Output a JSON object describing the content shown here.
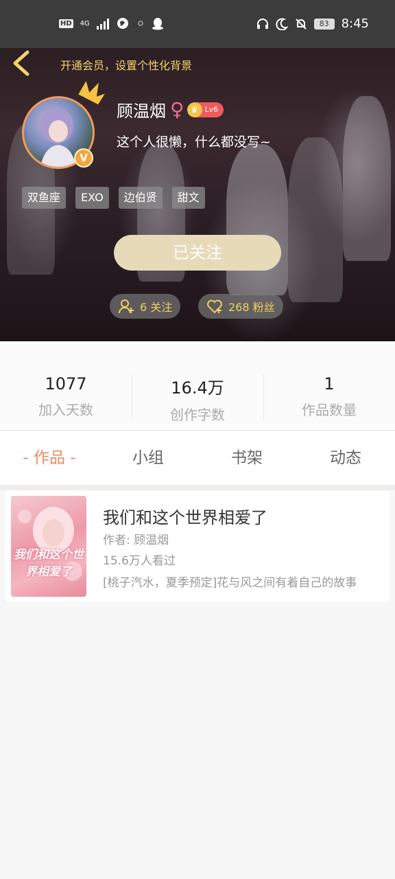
{
  "status_bar": {
    "hd": "HD",
    "network": "4G",
    "battery": "83",
    "time": "8:45"
  },
  "header": {
    "vip_link": "开通会员，设置个性化背景"
  },
  "profile": {
    "username": "顾温烟",
    "gender_symbol": "♀",
    "level": "Lv6",
    "verified_badge": "V",
    "bio": "这个人很懒，什么都没写~",
    "tags": [
      "双鱼座",
      "EXO",
      "边伯贤",
      "甜文"
    ],
    "follow_button": "已关注",
    "following": "6 关注",
    "fans": "268 粉丝"
  },
  "stats": [
    {
      "value": "1077",
      "label": "加入天数"
    },
    {
      "value": "16.4万",
      "label": "创作字数"
    },
    {
      "value": "1",
      "label": "作品数量"
    }
  ],
  "tabs": [
    {
      "label": "- 作品 -",
      "active": true
    },
    {
      "label": "小组",
      "active": false
    },
    {
      "label": "书架",
      "active": false
    },
    {
      "label": "动态",
      "active": false
    }
  ],
  "book": {
    "title": "我们和这个世界相爱了",
    "author": "作者: 顾温烟",
    "views": "15.6万人看过",
    "description": "[桃子汽水，夏季预定]花与风之间有着自己的故事",
    "cover_text": "我们和这个世界相爱了"
  },
  "colors": {
    "accent": "#ef8a5a",
    "gold": "#f1cf5c",
    "follow_button_bg": "#e6dab9"
  }
}
